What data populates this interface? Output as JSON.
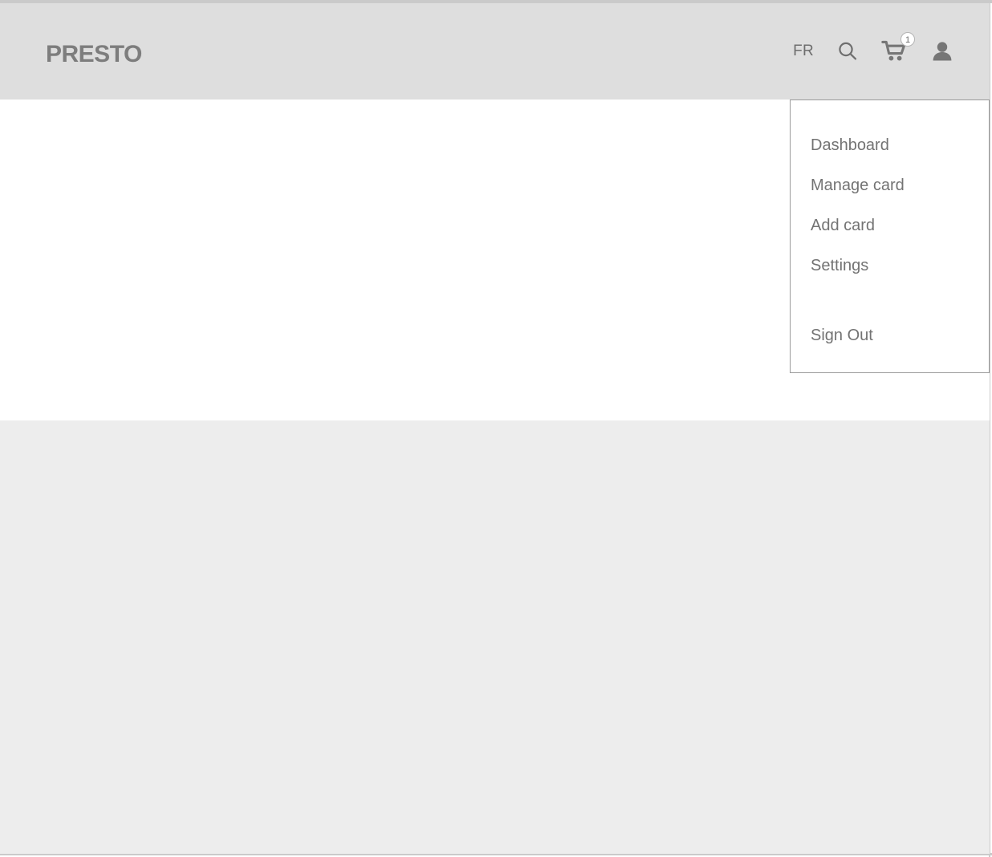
{
  "brand": {
    "logo_text": "PRESTO"
  },
  "header": {
    "language_toggle": "FR",
    "icons": {
      "search": "search-icon",
      "cart": "shopping-cart-icon",
      "account": "person-icon"
    },
    "cart_badge_count": "1"
  },
  "account_menu": {
    "visible": true,
    "items": [
      {
        "label": "Dashboard"
      },
      {
        "label": "Manage card"
      },
      {
        "label": "Add card"
      },
      {
        "label": "Settings"
      },
      {
        "label": "Sign Out"
      }
    ]
  },
  "colors": {
    "header_bg": "#dedede",
    "page_bg": "#ffffff",
    "lower_band_bg": "#ededed",
    "text_gray": "#737373",
    "logo_gray": "#7d7d7d",
    "menu_border": "#9a9a9a",
    "frame_line": "#cacaca"
  }
}
